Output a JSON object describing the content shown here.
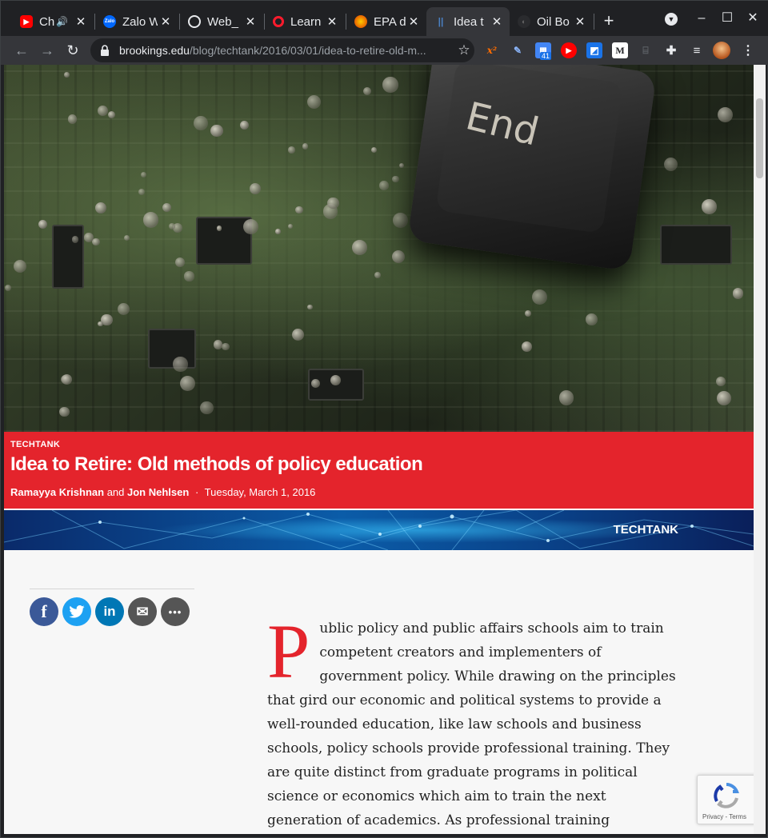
{
  "browser": {
    "tabs": [
      {
        "title": "Ch",
        "favicon": "youtube-icon",
        "color": "#ff0000",
        "glyph": "▶",
        "audio": true
      },
      {
        "title": "Zalo W",
        "favicon": "zalo-icon",
        "color": "#0068ff",
        "glyph": "Zalo"
      },
      {
        "title": "Web_",
        "favicon": "github-icon",
        "color": "#ffffff",
        "glyph": "●"
      },
      {
        "title": "Learn",
        "favicon": "opera-icon",
        "color": "#ff1b2d",
        "glyph": "O"
      },
      {
        "title": "EPA d",
        "favicon": "firefox-icon",
        "color": "#e66000",
        "glyph": "✺"
      },
      {
        "title": "Idea t",
        "favicon": "brookings-icon",
        "color": "#003a70",
        "glyph": "||",
        "active": true
      },
      {
        "title": "Oil Bo",
        "favicon": "page-icon",
        "color": "#3c4043",
        "glyph": "◐"
      }
    ],
    "new_tab": "+",
    "window_controls": {
      "minimize": "–",
      "maximize": "☐",
      "close": "✕"
    },
    "url_host": "brookings.edu",
    "url_path": "/blog/techtank/2016/03/01/idea-to-retire-old-m...",
    "extension_badge": "41",
    "extensions": [
      {
        "name": "superscript-icon",
        "glyph": "x²",
        "color": "#ff6d00"
      },
      {
        "name": "pen-icon",
        "glyph": "✎",
        "color": "#8ab4f8"
      },
      {
        "name": "calendar-icon",
        "glyph": "▦",
        "color": "#4285f4"
      },
      {
        "name": "youtube-ext-icon",
        "glyph": "▶",
        "color": "#ff0000"
      },
      {
        "name": "bookmark-ext-icon",
        "glyph": "◩",
        "color": "#1a73e8"
      },
      {
        "name": "m-icon",
        "glyph": "M",
        "color": "#ffffff"
      },
      {
        "name": "ribbon-icon",
        "glyph": "⌸",
        "color": "#5f6368"
      },
      {
        "name": "puzzle-icon",
        "glyph": "✚",
        "color": "#e8eaed"
      },
      {
        "name": "media-icon",
        "glyph": "≡",
        "color": "#e8eaed"
      }
    ]
  },
  "article": {
    "kicker": "TECHTANK",
    "title": "Idea to Retire: Old methods of policy education",
    "author1": "Ramayya Krishnan",
    "and": "and",
    "author2": "Jon Nehlsen",
    "separator": "·",
    "date": "Tuesday, March 1, 2016",
    "banner_label": "TECHTANK",
    "hero_key_label": "End",
    "dropcap": "P",
    "body_first": "ublic policy and public affairs schools aim to train competent creators and implementers of government policy. While drawing on the principles that gird our economic and political systems to provide a well-rounded education, like law schools and business schools, policy schools provide professional training. They are quite distinct from graduate programs in political science or economics which aim to train the next generation of academics. As professional training programs, they add value by imparting both the skills"
  },
  "share": [
    {
      "name": "facebook-share-button",
      "glyph": "f",
      "color": "#3b5998"
    },
    {
      "name": "twitter-share-button",
      "glyph": "🐦",
      "color": "#1da1f2"
    },
    {
      "name": "linkedin-share-button",
      "glyph": "in",
      "color": "#0077b5"
    },
    {
      "name": "email-share-button",
      "glyph": "✉",
      "color": "#555555"
    },
    {
      "name": "more-share-button",
      "glyph": "•••",
      "color": "#555555"
    }
  ],
  "recaptcha": {
    "links": "Privacy - Terms"
  },
  "colors": {
    "brand_red": "#e4242c",
    "banner_blue": "#0b5ca8"
  }
}
